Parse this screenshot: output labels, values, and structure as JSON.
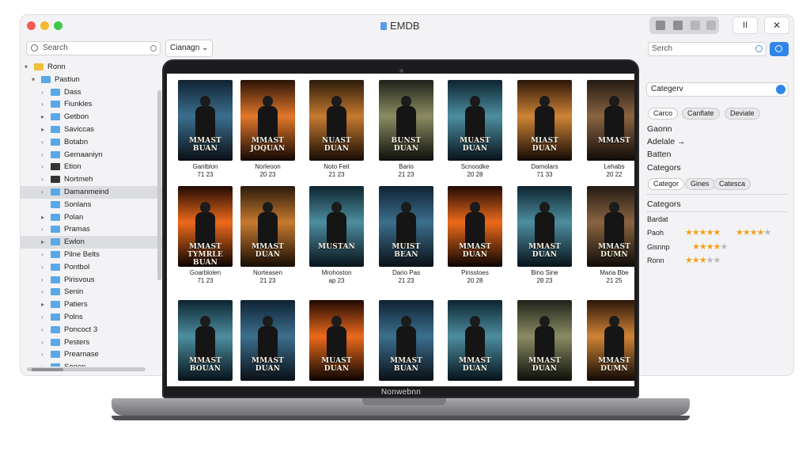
{
  "window": {
    "title": "EMDB",
    "pause_label": "II",
    "close_label": "✕"
  },
  "left": {
    "search_placeholder": "Search",
    "dropdown_label": "Cianagn ⌄",
    "tree": [
      {
        "label": "Ronn",
        "level": 0,
        "arrow": "▾",
        "icon": "folder-yellow"
      },
      {
        "label": "Pastiun",
        "level": 1,
        "arrow": "▾",
        "icon": "folder"
      },
      {
        "label": "Dass",
        "level": 2,
        "arrow": "›",
        "icon": "folder"
      },
      {
        "label": "Fiunkles",
        "level": 2,
        "arrow": "›",
        "icon": "folder"
      },
      {
        "label": "Getbon",
        "level": 2,
        "arrow": "▸",
        "icon": "folder"
      },
      {
        "label": "Saviccas",
        "level": 2,
        "arrow": "▸",
        "icon": "folder-image"
      },
      {
        "label": "Botabn",
        "level": 2,
        "arrow": "›",
        "icon": "folder"
      },
      {
        "label": "Gemaaniyn",
        "level": 2,
        "arrow": "›",
        "icon": "folder"
      },
      {
        "label": "Etion",
        "level": 2,
        "arrow": "›",
        "icon": "folder-dark"
      },
      {
        "label": "Nortmeh",
        "level": 2,
        "arrow": "›",
        "icon": "folder-dark"
      },
      {
        "label": "Damanmeind",
        "level": 2,
        "arrow": "›",
        "icon": "folder",
        "selected": true
      },
      {
        "label": "Sonlans",
        "level": 2,
        "arrow": "",
        "icon": "folder"
      },
      {
        "label": "Polan",
        "level": 2,
        "arrow": "▸",
        "icon": "folder"
      },
      {
        "label": "Pramas",
        "level": 2,
        "arrow": "›",
        "icon": "folder"
      },
      {
        "label": "Ewlon",
        "level": 2,
        "arrow": "▸",
        "icon": "folder",
        "selected": true
      },
      {
        "label": "Pilne Belts",
        "level": 2,
        "arrow": "›",
        "icon": "folder"
      },
      {
        "label": "Pontbol",
        "level": 2,
        "arrow": "›",
        "icon": "folder"
      },
      {
        "label": "Pirisvous",
        "level": 2,
        "arrow": "›",
        "icon": "folder"
      },
      {
        "label": "Senin",
        "level": 2,
        "arrow": "›",
        "icon": "folder"
      },
      {
        "label": "Patiers",
        "level": 2,
        "arrow": "▸",
        "icon": "folder"
      },
      {
        "label": "Polns",
        "level": 2,
        "arrow": "›",
        "icon": "folder"
      },
      {
        "label": "Poncoct 3",
        "level": 2,
        "arrow": "›",
        "icon": "folder"
      },
      {
        "label": "Pesters",
        "level": 2,
        "arrow": "›",
        "icon": "folder"
      },
      {
        "label": "Prearnase",
        "level": 2,
        "arrow": "›",
        "icon": "folder"
      },
      {
        "label": "Seoen",
        "level": 2,
        "arrow": "›",
        "icon": "folder"
      }
    ]
  },
  "right": {
    "search_placeholder": "Serch",
    "category_select": "Categerv",
    "chips_row1": [
      "Carco",
      "Canflate",
      "Deviate"
    ],
    "lines": [
      "Gaonn",
      "Adelale →",
      "Batten",
      "Categors"
    ],
    "chips_row2": [
      "Categor",
      "Gines",
      "Catesca"
    ],
    "section_title": "Categors",
    "section_marker": "•",
    "rating_header": "Bardat",
    "ratings": [
      {
        "label": "Paoh",
        "stars": 4.5,
        "stars2": 4
      },
      {
        "label": "Gisnnp",
        "stars": 3.5
      },
      {
        "label": "Ronn",
        "stars": 2.5
      }
    ]
  },
  "laptop": {
    "brand": "Nonwebnn"
  },
  "movies": [
    [
      {
        "title": "MMAST BUAN",
        "caption1": "Ganlblon",
        "caption2": "71 23",
        "palette": "blue"
      },
      {
        "title": "MMAST JOQUAN",
        "caption1": "Norleoon",
        "caption2": "20 23",
        "palette": "orange"
      },
      {
        "title": "NUAST DUAN",
        "caption1": "Noto Feit",
        "caption2": "21 23",
        "palette": "amber"
      },
      {
        "title": "BUNST DUAN",
        "caption1": "Bario",
        "caption2": "21 23",
        "palette": "olive"
      },
      {
        "title": "MUAST DUAN",
        "caption1": "Scnoodke",
        "caption2": "20 28",
        "palette": "teal"
      },
      {
        "title": "MIAST DUAN",
        "caption1": "Damolars",
        "caption2": "71 33",
        "palette": "sunset"
      },
      {
        "title": "MMAST",
        "caption1": "Lehabs",
        "caption2": "20 22",
        "palette": "brown"
      }
    ],
    [
      {
        "title": "MMAST TYMRLE BUAN",
        "caption1": "Goarblolen",
        "caption2": "71 23",
        "palette": "fire"
      },
      {
        "title": "MMAST DUAN",
        "caption1": "Norteasen",
        "caption2": "21 23",
        "palette": "amber"
      },
      {
        "title": "MUSTAN",
        "caption1": "Mrohoston",
        "caption2": "ap 23",
        "palette": "teal"
      },
      {
        "title": "MUIST BEAN",
        "caption1": "Dario Pas",
        "caption2": "21 23",
        "palette": "blue"
      },
      {
        "title": "MMAST DUAN",
        "caption1": "Pinsstoes",
        "caption2": "20 28",
        "palette": "fire"
      },
      {
        "title": "MMAST DUAN",
        "caption1": "Bino Sine",
        "caption2": "28 23",
        "palette": "teal"
      },
      {
        "title": "MMAST DUMN",
        "caption1": "Maria Bbe",
        "caption2": "21 25",
        "palette": "brown"
      }
    ],
    [
      {
        "title": "MMAST BOUAN",
        "caption1": "",
        "caption2": "",
        "palette": "teal"
      },
      {
        "title": "MMAST DUAN",
        "caption1": "",
        "caption2": "",
        "palette": "blue"
      },
      {
        "title": "MUAST DUAN",
        "caption1": "",
        "caption2": "",
        "palette": "fire"
      },
      {
        "title": "MMAST BUAN",
        "caption1": "",
        "caption2": "",
        "palette": "blue"
      },
      {
        "title": "MMAST DUAN",
        "caption1": "",
        "caption2": "",
        "palette": "teal"
      },
      {
        "title": "MMAST DUAN",
        "caption1": "",
        "caption2": "",
        "palette": "olive"
      },
      {
        "title": "MMAST DUMN",
        "caption1": "",
        "caption2": "",
        "palette": "sunset"
      }
    ]
  ],
  "colors": {
    "accent": "#2f86e8",
    "star": "#f0a21c",
    "folder": "#5aa8e8"
  }
}
